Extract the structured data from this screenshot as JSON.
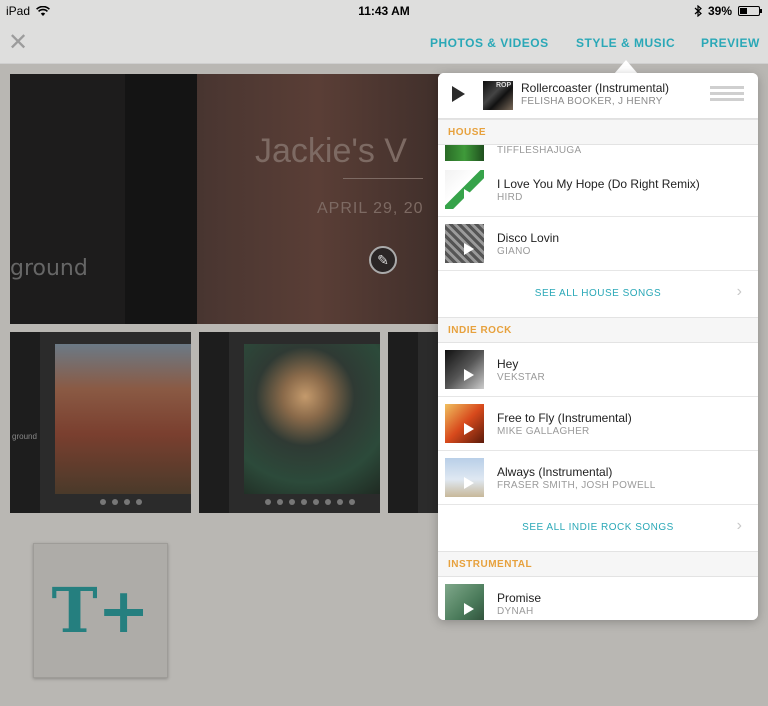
{
  "status_bar": {
    "device": "iPad",
    "time": "11:43 AM",
    "battery": "39%",
    "battery_level": 0.39
  },
  "nav": {
    "tabs": [
      "PHOTOS & VIDEOS",
      "STYLE & MUSIC",
      "PREVIEW"
    ]
  },
  "background": {
    "hero_title": "Jackie's V",
    "hero_date": "APRIL 29, 20",
    "hero_partial_word": "ground",
    "thumb_partial_word": "ground"
  },
  "now_playing": {
    "title": "Rollercoaster (Instrumental)",
    "artist": "FELISHA BOOKER, J HENRY",
    "art_text": "ROP"
  },
  "sections": [
    {
      "header": "HOUSE",
      "partial_artist": "TIFFLESHAJUGA",
      "songs": [
        {
          "title": "I Love You My Hope (Do Right Remix)",
          "artist": "HIRD"
        },
        {
          "title": "Disco Lovin",
          "artist": "GIANO"
        }
      ],
      "see_all": "SEE ALL HOUSE SONGS"
    },
    {
      "header": "INDIE ROCK",
      "songs": [
        {
          "title": "Hey",
          "artist": "VEKSTAR"
        },
        {
          "title": "Free to Fly (Instrumental)",
          "artist": "MIKE GALLAGHER"
        },
        {
          "title": "Always (Instrumental)",
          "artist": "FRASER SMITH, JOSH POWELL"
        }
      ],
      "see_all": "SEE ALL INDIE ROCK SONGS"
    },
    {
      "header": "INSTRUMENTAL",
      "songs": [
        {
          "title": "Promise",
          "artist": "DYNAH"
        }
      ]
    }
  ],
  "colors": {
    "accent": "#2aa8b7",
    "section_header": "#e7a13d"
  }
}
